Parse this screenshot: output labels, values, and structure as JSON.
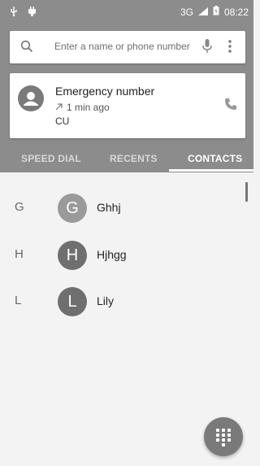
{
  "status_bar": {
    "network": "3G",
    "time": "08:22",
    "icons": [
      "usb-icon",
      "android-debug-icon",
      "signal-icon",
      "battery-icon"
    ]
  },
  "search": {
    "placeholder": "Enter a name or phone number"
  },
  "recent_card": {
    "name": "Emergency number",
    "time_ago": "1 min ago",
    "label": "CU"
  },
  "tabs": {
    "speed_dial": "SPEED DIAL",
    "recents": "RECENTS",
    "contacts": "CONTACTS",
    "selected": "CONTACTS"
  },
  "contacts": [
    {
      "section": "G",
      "initial": "G",
      "name": "Ghhj"
    },
    {
      "section": "H",
      "initial": "H",
      "name": "Hjhgg"
    },
    {
      "section": "L",
      "initial": "L",
      "name": "Lily"
    }
  ],
  "colors": {
    "header": "#8c8c8c",
    "avatar_light": "#9a9a9a",
    "avatar_dark": "#6f6f6f",
    "fab": "#7a7a7a"
  }
}
